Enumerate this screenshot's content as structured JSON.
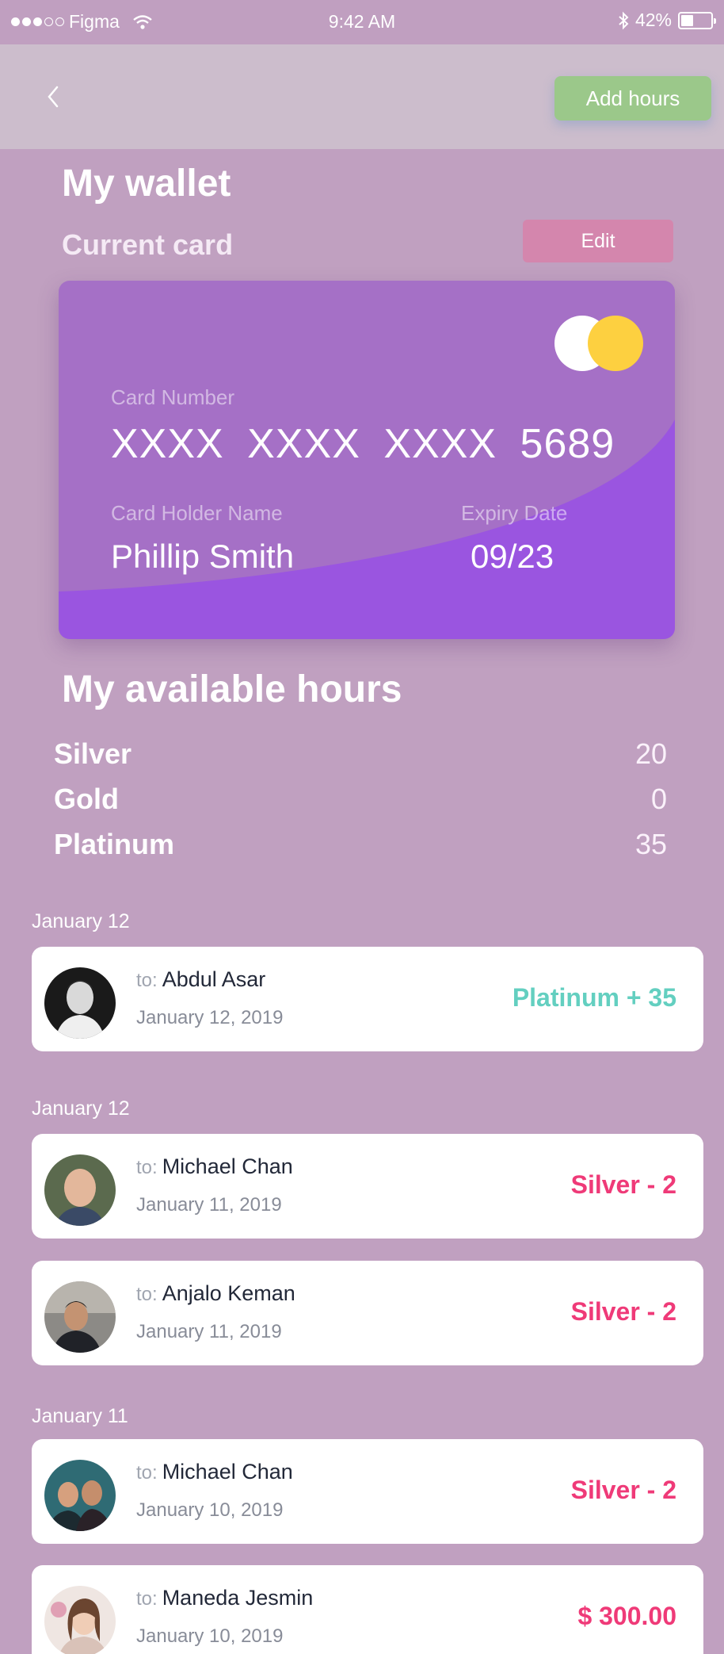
{
  "status_bar": {
    "carrier": "Figma",
    "time": "9:42 AM",
    "battery": "42%",
    "battery_level": 0.42
  },
  "nav": {
    "back_icon": "chevron-left-icon",
    "add_hours_label": "Add hours"
  },
  "wallet": {
    "title": "My wallet",
    "current_card_label": "Current card",
    "edit_label": "Edit"
  },
  "card": {
    "number_label": "Card Number",
    "number": "XXXX XXXX XXXX 5689",
    "holder_label": "Card Holder Name",
    "holder": "Phillip Smith",
    "expiry_label": "Expiry Date",
    "expiry": "09/23",
    "colors": {
      "base": "#a570c6",
      "wave": "#9a55e0",
      "logo_left": "#ffffff",
      "logo_right": "#fdd040"
    }
  },
  "hours": {
    "title": "My available hours",
    "items": [
      {
        "name": "Silver",
        "value": "20"
      },
      {
        "name": "Gold",
        "value": "0"
      },
      {
        "name": "Platinum",
        "value": "35"
      }
    ]
  },
  "transactions": {
    "to_prefix": "to:",
    "groups": [
      {
        "date": "January 12",
        "items": [
          {
            "name": "Abdul Asar",
            "date": "January 12, 2019",
            "amount": "Platinum + 35",
            "type": "plus"
          }
        ]
      },
      {
        "date": "January 12",
        "items": [
          {
            "name": "Michael Chan",
            "date": "January 11, 2019",
            "amount": "Silver - 2",
            "type": "minus"
          },
          {
            "name": "Anjalo Keman",
            "date": "January 11, 2019",
            "amount": "Silver - 2",
            "type": "minus"
          }
        ]
      },
      {
        "date": "January 11",
        "items": [
          {
            "name": "Michael Chan",
            "date": "January 10, 2019",
            "amount": "Silver - 2",
            "type": "minus"
          },
          {
            "name": "Maneda Jesmin",
            "date": "January 10, 2019",
            "amount": "$ 300.00",
            "type": "minus"
          }
        ]
      }
    ]
  }
}
